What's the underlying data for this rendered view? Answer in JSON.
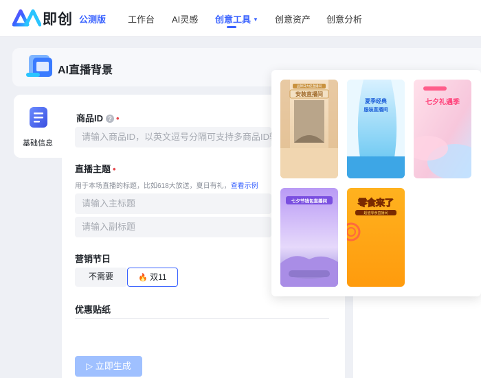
{
  "nav": {
    "brand": "即创",
    "badge": "公测版",
    "items": [
      {
        "label": "工作台"
      },
      {
        "label": "AI灵感"
      },
      {
        "label": "创意工具"
      },
      {
        "label": "创意资产"
      },
      {
        "label": "创意分析"
      }
    ],
    "active_index": 2,
    "caret": "▼"
  },
  "header": {
    "title": "AI直播背景"
  },
  "side_tab": {
    "label": "基础信息"
  },
  "form": {
    "product_id": {
      "label": "商品ID",
      "help": "?",
      "required": "•",
      "placeholder": "请输入商品ID，以英文逗号分隔可支持多商品ID输入"
    },
    "theme": {
      "label": "直播主题",
      "required": "•",
      "hint": "用于本场直播的标题，比如618大放送，夏日有礼，",
      "hint_link": "查看示例",
      "main_placeholder": "请输入主标题",
      "sub_placeholder": "请输入副标题"
    },
    "festival": {
      "label": "营销节日",
      "options": [
        {
          "label": "不需要"
        },
        {
          "label": "双11",
          "icon": "flame-icon"
        }
      ],
      "selected": "双11"
    },
    "sticker": {
      "label": "优惠贴纸"
    },
    "generate_button": {
      "icon": "▷",
      "label": "立即生成"
    }
  },
  "popover": {
    "thumbnails": [
      {
        "name": "thumb-beige-stage",
        "title": "安装直播间",
        "banner": "品牌日大促直播间"
      },
      {
        "name": "thumb-blue-curtain",
        "title": "夏季经典",
        "subtitle": "服装直播间"
      },
      {
        "name": "thumb-pink-qixi",
        "title": "七夕礼遇季"
      },
      {
        "name": "thumb-purple-qixi",
        "title": "七夕节钱包直播间"
      },
      {
        "name": "thumb-orange-snack",
        "title": "零食来了",
        "subtitle": "超值零食直播间"
      }
    ]
  },
  "colors": {
    "accent": "#3a63ff",
    "required": "#e5484d",
    "button_disabled": "#9fc0ff"
  }
}
